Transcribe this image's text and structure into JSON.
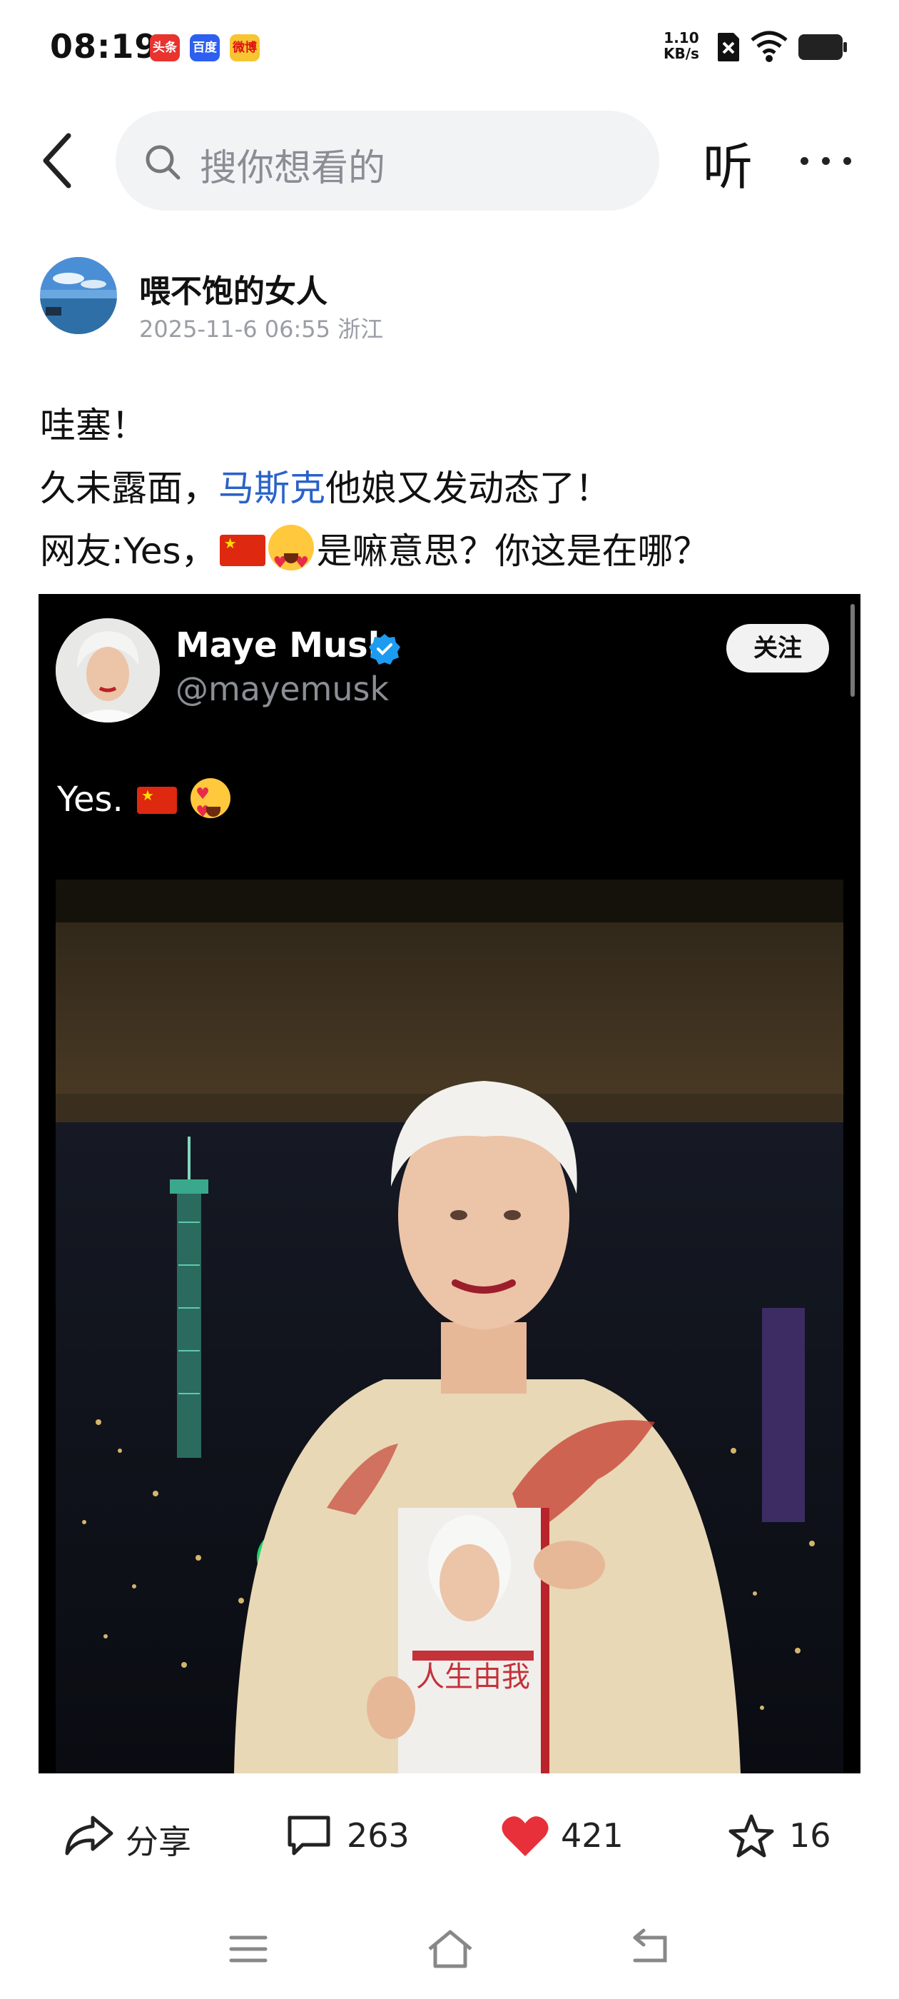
{
  "status_bar": {
    "time": "08:19",
    "app_badges": [
      "头条",
      "百度",
      "微博"
    ],
    "net_speed_value": "1.10",
    "net_speed_unit": "KB/s"
  },
  "header": {
    "search_placeholder": "搜你想看的",
    "listen_label": "听"
  },
  "author": {
    "name": "喂不饱的女人",
    "meta": "2025-11-6 06:55 浙江"
  },
  "post": {
    "line1": "哇塞！",
    "line2_link": "马斯克",
    "line2_rest": "他娘又发动态了！",
    "line2_prefix": "久未露面，",
    "line3_prefix": "网友:Yes，",
    "line3_rest": "是嘛意思？你这是在哪？"
  },
  "embed": {
    "name": "Maye Musk",
    "handle": "@mayemusk",
    "follow_label": "关注",
    "tweet_text": "Yes.",
    "book_title": "人生由我"
  },
  "actions": {
    "share_label": "分享",
    "comments": "263",
    "likes": "421",
    "favorites": "16"
  },
  "colors": {
    "link": "#2a62c9",
    "like": "#e8303a",
    "search_bg": "#f2f3f5"
  }
}
